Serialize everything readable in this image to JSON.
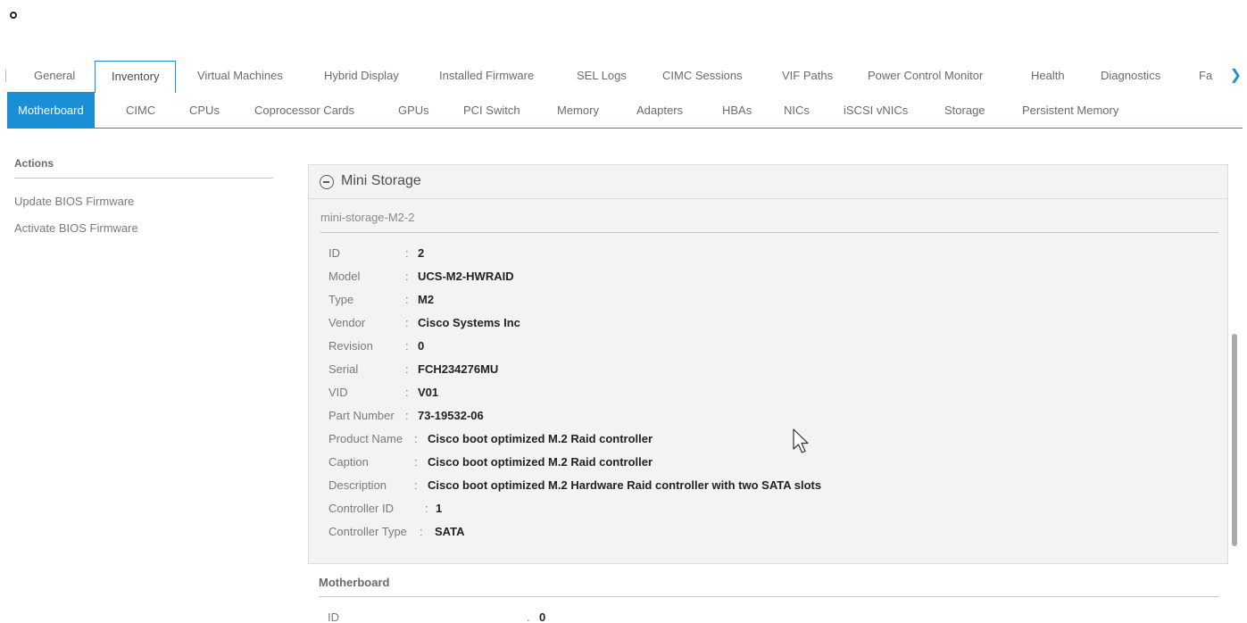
{
  "tabs": [
    {
      "label": "General",
      "active": false
    },
    {
      "label": "Inventory",
      "active": true
    },
    {
      "label": "Virtual Machines",
      "active": false
    },
    {
      "label": "Hybrid Display",
      "active": false
    },
    {
      "label": "Installed Firmware",
      "active": false
    },
    {
      "label": "SEL Logs",
      "active": false
    },
    {
      "label": "CIMC Sessions",
      "active": false
    },
    {
      "label": "VIF Paths",
      "active": false
    },
    {
      "label": "Power Control Monitor",
      "active": false
    },
    {
      "label": "Health",
      "active": false
    },
    {
      "label": "Diagnostics",
      "active": false
    },
    {
      "label": "Fa",
      "active": false
    }
  ],
  "tab_more_icon": "chevron-right",
  "subtabs": [
    {
      "label": "Motherboard",
      "active": true
    },
    {
      "label": "CIMC",
      "active": false
    },
    {
      "label": "CPUs",
      "active": false
    },
    {
      "label": "Coprocessor Cards",
      "active": false
    },
    {
      "label": "GPUs",
      "active": false
    },
    {
      "label": "PCI Switch",
      "active": false
    },
    {
      "label": "Memory",
      "active": false
    },
    {
      "label": "Adapters",
      "active": false
    },
    {
      "label": "HBAs",
      "active": false
    },
    {
      "label": "NICs",
      "active": false
    },
    {
      "label": "iSCSI vNICs",
      "active": false
    },
    {
      "label": "Storage",
      "active": false
    },
    {
      "label": "Persistent Memory",
      "active": false
    }
  ],
  "actions": {
    "title": "Actions",
    "items": [
      "Update BIOS Firmware",
      "Activate BIOS Firmware"
    ]
  },
  "mini_storage": {
    "title": "Mini Storage",
    "subheading": "mini-storage-M2-2",
    "fields": [
      {
        "label": "ID",
        "value": "2"
      },
      {
        "label": "Model",
        "value": "UCS-M2-HWRAID"
      },
      {
        "label": "Type",
        "value": "M2"
      },
      {
        "label": "Vendor",
        "value": "Cisco Systems Inc"
      },
      {
        "label": "Revision",
        "value": "0"
      },
      {
        "label": "Serial",
        "value": "FCH234276MU"
      },
      {
        "label": "VID",
        "value": "V01"
      },
      {
        "label": "Part Number",
        "value": "73-19532-06"
      },
      {
        "label": "Product Name",
        "value": "Cisco boot optimized M.2 Raid controller"
      },
      {
        "label": "Caption",
        "value": "Cisco boot optimized M.2 Raid controller"
      },
      {
        "label": "Description",
        "value": "Cisco boot optimized M.2 Hardware Raid controller with two SATA slots"
      },
      {
        "label": "Controller ID",
        "value": "1"
      },
      {
        "label": "Controller Type",
        "value": "SATA"
      }
    ]
  },
  "motherboard": {
    "title": "Motherboard",
    "fields": [
      {
        "label": "ID",
        "value": "0"
      }
    ]
  },
  "colors": {
    "accent": "#1b8fd6",
    "panel_bg": "#f3f3f3"
  }
}
